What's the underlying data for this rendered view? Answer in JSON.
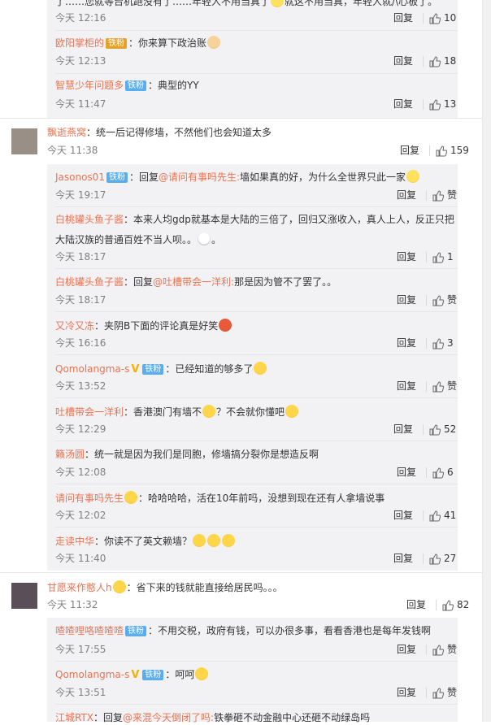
{
  "reply_label": "回复",
  "zan_label": "赞",
  "sections": [
    {
      "replies": [
        {
          "name": "",
          "text": "了……您就等台机跑没有了……年轻人不用当真了",
          "text2": "就这不用当真，年轻人就/\\心板了。",
          "time": "今天 12:16",
          "likes": "10"
        },
        {
          "name": "欧阳掌柜的",
          "badge": "铁粉",
          "text": "：你来算下政治账",
          "time": "今天 12:13",
          "likes": "18"
        },
        {
          "name": "智慧少年问题多",
          "badge": "铁粉",
          "text": "：典型的YY",
          "time": "今天 11:47",
          "likes": "13"
        }
      ]
    },
    {
      "author": "飘逝燕窝",
      "text": "：统一后记得修墙，不然他们也会知道太多",
      "time": "今天 11:38",
      "likes": "159",
      "replies": [
        {
          "name": "Jasonos01",
          "badge": "铁粉",
          "text_before": "：回复",
          "at": "@请问有事吗先生:",
          "text": "墙如果真的好，为什么全世界只此一家",
          "time": "今天 19:17",
          "likes": "赞"
        },
        {
          "name": "白桃罐头鱼子酱",
          "text": "：本来人均gdp就基本是大陆的三倍了，回归又涨收入，真人上人，反正只把",
          "text2": "大陆汉族的普通百姓不当人呗。。",
          "text3": "。",
          "time": "今天 18:17",
          "likes": "1"
        },
        {
          "name": "白桃罐头鱼子酱",
          "text_before": "：回复",
          "at": "@吐槽带会一洋利:",
          "text": "那是因为管不了罢了。。",
          "time": "今天 18:17",
          "likes": "赞"
        },
        {
          "name": "又冷又冻",
          "text": "：夹阴B下面的评论真是好笑",
          "time": "今天 16:16",
          "likes": "3"
        },
        {
          "name": "Qomolangma-s",
          "badge": "铁粉",
          "text": "：已经知道的够多了",
          "time": "今天 13:52",
          "likes": "赞"
        },
        {
          "name": "吐槽带会一洋利",
          "text": "：香港澳门有墙不",
          "text2": "？不会就你懂吧",
          "time": "今天 12:29",
          "likes": "52"
        },
        {
          "name": "籁汤圆",
          "text": "：统一就是因为我们是同胞，修墙搞分裂你是想造反啊",
          "time": "今天 12:08",
          "likes": "6"
        },
        {
          "name": "请问有事吗先生",
          "text": "：哈哈哈哈，活在10年前吗，没想到现在还有人拿墙说事",
          "time": "今天 12:02",
          "likes": "41"
        },
        {
          "name": "走读中华",
          "text": "：你读不了英文赖墙？",
          "time": "今天 11:40",
          "likes": "27"
        }
      ]
    },
    {
      "author": "甘愿来作憨人h",
      "text": "：省下来的钱就能直接给居民吗。。。",
      "time": "今天 11:32",
      "likes": "82",
      "replies": [
        {
          "name": "喳喳哩咯喳喳喳",
          "badge": "铁粉",
          "text": "：不用交税，政府有钱，可以办很多事，看看香港也是每年发钱啊",
          "time": "今天 17:55",
          "likes": "赞"
        },
        {
          "name": "Qomolangma-s",
          "badge": "铁粉",
          "text": "：呵呵",
          "time": "今天 13:51",
          "likes": "赞"
        },
        {
          "name": "江城RTX",
          "text_before": "：回复",
          "at": "@来混今天倒闭了吗:",
          "text": "铁拳砸不动金融中心还砸不动绿岛吗",
          "time": "",
          "likes": ""
        }
      ]
    }
  ]
}
